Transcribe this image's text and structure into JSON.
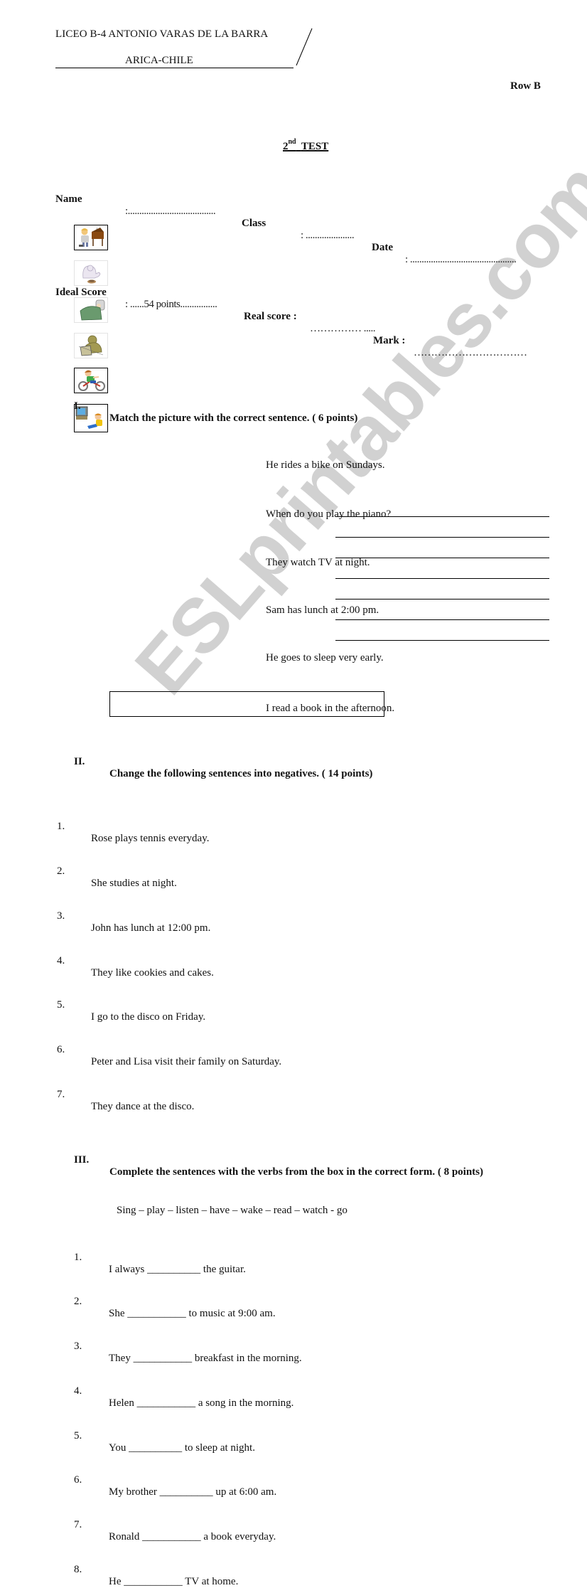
{
  "header": {
    "school": "LICEO B-4 ANTONIO VARAS DE LA BARRA",
    "city": "ARICA-CHILE",
    "row": "Row B"
  },
  "title": {
    "ordinal": "2",
    "suffix": "nd",
    "word": "TEST"
  },
  "info": {
    "name_label": "Name",
    "name_value": ":......................................",
    "class_label": "Class",
    "class_value": ": .....................",
    "date_label": "Date",
    "date_value": ": ..............................................",
    "ideal_label": "Ideal Score",
    "ideal_value": ": ......54 points................",
    "real_label": "Real score :",
    "real_value": "…………… .....",
    "mark_label": "Mark :",
    "mark_value": "……………………………"
  },
  "section1": {
    "num": "I.",
    "heading": "Match the picture with the correct sentence. ( 6 points)",
    "pictures": [
      {
        "icon": "boy-playing-piano-icon",
        "framed": true
      },
      {
        "icon": "person-having-lunch-icon",
        "framed": false
      },
      {
        "icon": "person-sleeping-in-bed-icon",
        "framed": false
      },
      {
        "icon": "person-reading-book-icon",
        "framed": false
      },
      {
        "icon": "boy-riding-bike-icon",
        "framed": true
      },
      {
        "icon": "boy-watching-tv-icon",
        "framed": true
      }
    ],
    "sentences": [
      "He rides a bike on Sundays.",
      "When do you play the piano?",
      "They watch TV at night.",
      "Sam has lunch at 2:00 pm.",
      "He goes to sleep very early.",
      "I read a book in the afternoon."
    ]
  },
  "section2": {
    "num": "II.",
    "heading": "Change the following sentences into negatives. ( 14 points)",
    "items": [
      {
        "n": "1.",
        "text": "Rose plays tennis everyday."
      },
      {
        "n": "2.",
        "text": "She studies at night."
      },
      {
        "n": "3.",
        "text": "John has lunch at 12:00 pm."
      },
      {
        "n": "4.",
        "text": "They like cookies and cakes."
      },
      {
        "n": "5.",
        "text": "I go to the disco on Friday."
      },
      {
        "n": "6.",
        "text": "Peter and Lisa visit their family on Saturday."
      },
      {
        "n": "7.",
        "text": "They dance at the disco."
      }
    ]
  },
  "section3": {
    "num": "III.",
    "heading": "Complete the sentences with the verbs from the box in the correct form. ( 8 points)",
    "verb_box": "Sing – play – listen – have – wake – read – watch - go",
    "items": [
      {
        "n": "1.",
        "text": "I always __________ the guitar."
      },
      {
        "n": "2.",
        "text": "She ___________ to music at 9:00 am."
      },
      {
        "n": "3.",
        "text": "They ___________ breakfast in the morning."
      },
      {
        "n": "4.",
        "text": "Helen ___________ a song in the morning."
      },
      {
        "n": "5.",
        "text": "You __________ to sleep at night."
      },
      {
        "n": "6.",
        "text": "My brother __________ up at 6:00 am."
      },
      {
        "n": "7.",
        "text": "Ronald ___________ a book everyday."
      },
      {
        "n": "8.",
        "text": "He ___________ TV at home."
      }
    ]
  },
  "watermark": "ESLprintables.com"
}
